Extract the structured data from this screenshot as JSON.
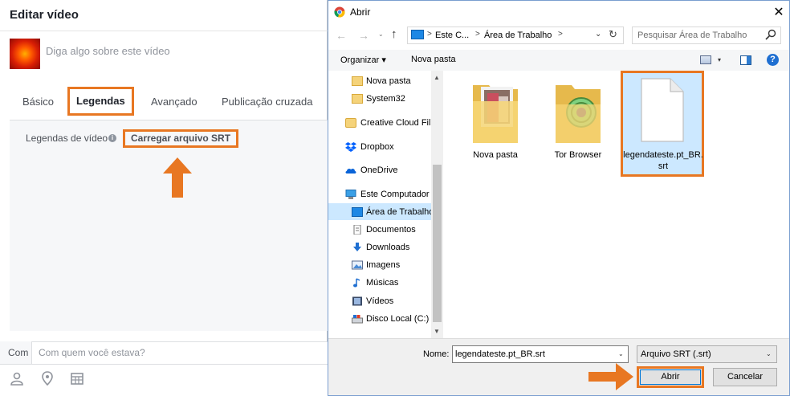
{
  "facebook": {
    "title": "Editar vídeo",
    "description_placeholder": "Diga algo sobre este vídeo",
    "tabs": [
      {
        "label": "Básico"
      },
      {
        "label": "Legendas"
      },
      {
        "label": "Avançado"
      },
      {
        "label": "Publicação cruzada"
      }
    ],
    "captions_label": "Legendas de vídeo",
    "info_glyph": "i",
    "upload_button": "Carregar arquivo SRT",
    "with_prefix": "Com",
    "with_placeholder": "Com quem você estava?",
    "icons": [
      "tag-person-icon",
      "location-pin-icon",
      "calendar-grid-icon"
    ]
  },
  "dialog": {
    "title": "Abrir",
    "close_glyph": "✕",
    "nav_glyphs": {
      "back": "←",
      "forward": "→",
      "history": "⌄",
      "up": "↑",
      "refresh": "↻",
      "dropdown": "⌄"
    },
    "breadcrumb": [
      {
        "label": "Este C..."
      },
      {
        "label": "Área de Trabalho"
      }
    ],
    "breadcrumb_sep": ">",
    "search_placeholder": "Pesquisar Área de Trabalho",
    "toolbar": {
      "organize": "Organizar ▾",
      "new_folder": "Nova pasta",
      "view_drop": "▾",
      "help": "?"
    },
    "nav_items": [
      {
        "label": "Nova pasta",
        "icon": "folder-icon"
      },
      {
        "label": "System32",
        "icon": "folder-icon"
      },
      {
        "label": "Creative Cloud Fil",
        "icon": "creative-cloud-icon"
      },
      {
        "label": "Dropbox",
        "icon": "dropbox-icon"
      },
      {
        "label": "OneDrive",
        "icon": "onedrive-icon"
      },
      {
        "label": "Este Computador",
        "icon": "computer-icon"
      },
      {
        "label": "Área de Trabalho",
        "icon": "desktop-icon"
      },
      {
        "label": "Documentos",
        "icon": "documents-icon"
      },
      {
        "label": "Downloads",
        "icon": "downloads-icon"
      },
      {
        "label": "Imagens",
        "icon": "images-icon"
      },
      {
        "label": "Músicas",
        "icon": "music-icon"
      },
      {
        "label": "Vídeos",
        "icon": "videos-icon"
      },
      {
        "label": "Disco Local (C:)",
        "icon": "local-disk-icon"
      }
    ],
    "scroll_glyphs": {
      "up": "▲",
      "down": "▼"
    },
    "files": [
      {
        "label": "Nova pasta",
        "icon": "folder-with-photo-icon"
      },
      {
        "label": "Tor Browser",
        "icon": "folder-tor-icon"
      },
      {
        "label": "legendateste.pt_BR.srt",
        "icon": "blank-file-icon"
      }
    ],
    "name_label": "Nome:",
    "name_value": "legendateste.pt_BR.srt",
    "file_type": "Arquivo SRT (.srt)",
    "dropdown_glyph": "⌄",
    "open_button": "Abrir",
    "cancel_button": "Cancelar"
  },
  "colors": {
    "highlight": "#e87722",
    "selection": "#cce8ff",
    "accent": "#0078d7"
  }
}
